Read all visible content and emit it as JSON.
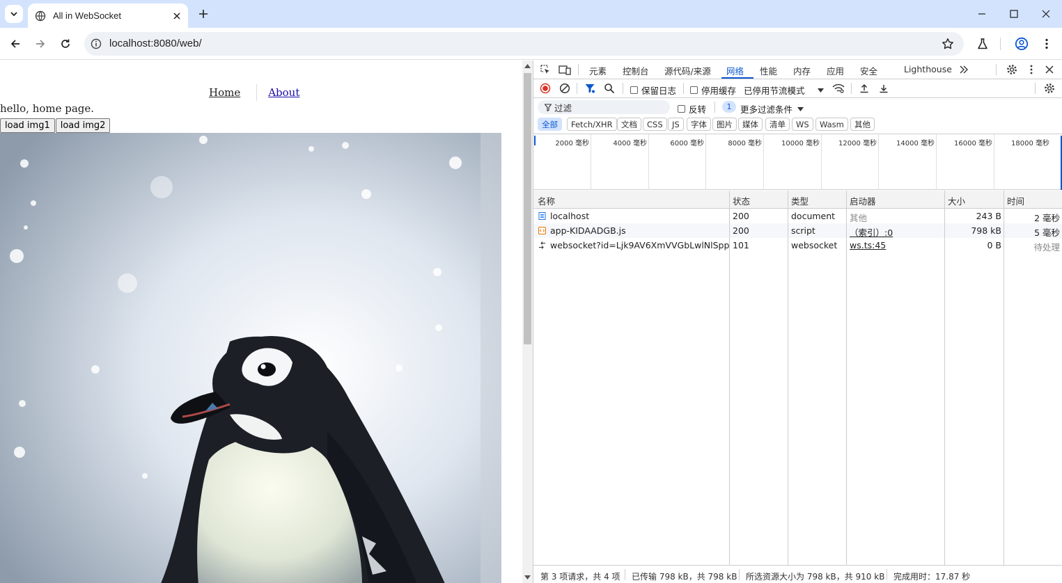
{
  "browser": {
    "tab_title": "All in WebSocket",
    "url": "localhost:8080/web/"
  },
  "page": {
    "nav_home": "Home",
    "nav_about": "About",
    "hello_text": "hello, home page.",
    "btn_img1": "load img1",
    "btn_img2": "load img2"
  },
  "devtools": {
    "tabs": [
      "元素",
      "控制台",
      "源代码/来源",
      "网络",
      "性能",
      "内存",
      "应用",
      "安全",
      "Lighthouse"
    ],
    "active_tab": "网络",
    "toolbar": {
      "preserve_log": "保留日志",
      "disable_cache": "停用缓存",
      "throttle": "已停用节流模式"
    },
    "filter": {
      "placeholder": "过滤",
      "invert": "反转",
      "more_count": "1",
      "more_filters": "更多过滤条件"
    },
    "type_filters": [
      "全部",
      "Fetch/XHR",
      "文档",
      "CSS",
      "JS",
      "字体",
      "图片",
      "媒体",
      "清单",
      "WS",
      "Wasm",
      "其他"
    ],
    "overview_ticks": [
      "2000 毫秒",
      "4000 毫秒",
      "6000 毫秒",
      "8000 毫秒",
      "10000 毫秒",
      "12000 毫秒",
      "14000 毫秒",
      "16000 毫秒",
      "18000 毫秒"
    ],
    "columns": {
      "name": "名称",
      "status": "状态",
      "type": "类型",
      "initiator": "启动器",
      "size": "大小",
      "time": "时间"
    },
    "rows": [
      {
        "name": "localhost",
        "status": "200",
        "type": "document",
        "initiator": "其他",
        "size": "243 B",
        "time": "2 毫秒",
        "icon": "document-icon"
      },
      {
        "name": "app-KIDAADGB.js",
        "status": "200",
        "type": "script",
        "initiator": "（索引）:0",
        "size": "798 kB",
        "time": "5 毫秒",
        "icon": "script-icon"
      },
      {
        "name": "websocket?id=Ljk9AV6XmVVGbLwlNlSpp",
        "status": "101",
        "type": "websocket",
        "initiator": "ws.ts:45",
        "size": "0 B",
        "time": "待处理",
        "icon": "websocket-icon"
      }
    ],
    "status": {
      "requests": "第 3 项请求，共 4 项",
      "transferred": "已传输 798 kB，共 798 kB",
      "resources": "所选资源大小为 798 kB，共 910 kB",
      "finish": "完成用时：17.87 秒"
    }
  },
  "colors": {
    "accent": "#0b57d0",
    "tabstrip": "#d3e3fd",
    "record": "#d93025"
  }
}
